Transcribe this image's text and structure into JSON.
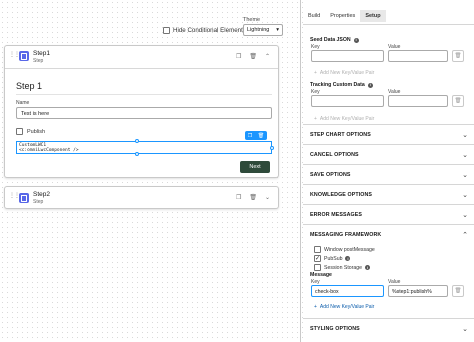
{
  "canvas": {
    "hide_conditional_elements": "Hide Conditional Elements",
    "theme_label": "Theme",
    "theme_value": "Lightning"
  },
  "step1": {
    "title": "Step1",
    "subtitle": "Step",
    "heading": "Step 1",
    "name_label": "Name",
    "name_value": "Test is here",
    "publish_label": "Publish",
    "lwc_line1": "CustomLWC1",
    "lwc_line2": "<c:omniLwcComponent />",
    "next_label": "Next"
  },
  "step2": {
    "title": "Step2",
    "subtitle": "Step"
  },
  "panel": {
    "tabs": [
      "Build",
      "Properties",
      "Setup"
    ],
    "seed": {
      "title": "Seed Data JSON",
      "key_label": "Key",
      "value_label": "Value",
      "add_label": "Add New Key/Value Pair"
    },
    "tracking": {
      "title": "Tracking Custom Data",
      "key_label": "Key",
      "value_label": "Value",
      "add_label": "Add New Key/Value Pair"
    },
    "sections": [
      "STEP CHART OPTIONS",
      "CANCEL OPTIONS",
      "SAVE OPTIONS",
      "KNOWLEDGE OPTIONS",
      "ERROR MESSAGES",
      "MESSAGING FRAMEWORK"
    ],
    "messaging": {
      "options": [
        {
          "label": "Window postMessage",
          "checked": false
        },
        {
          "label": "PubSub",
          "checked": true
        },
        {
          "label": "Session Storage",
          "checked": false
        }
      ],
      "message_title": "Message",
      "key_label": "Key",
      "value_label": "Value",
      "key_value": "check-box",
      "value_value": "%step1:publish%",
      "add_label": "Add New Key/Value Pair"
    },
    "styling": "STYLING OPTIONS"
  },
  "colors": {
    "accent": "#1b96ff",
    "step_icon": "#5867e8",
    "next_button": "#2e4a3a",
    "link": "#0b5cab"
  }
}
